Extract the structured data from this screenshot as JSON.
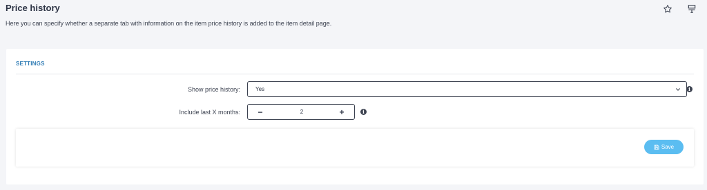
{
  "header": {
    "title": "Price history",
    "subtitle": "Here you can specify whether a separate tab with information on the item price history is added to the item detail page.",
    "icons": [
      "star-icon",
      "layout-icon"
    ]
  },
  "settings": {
    "section_title": "SETTINGS",
    "show_price_history": {
      "label": "Show price history:",
      "value": "Yes",
      "info_icon": "info-icon"
    },
    "include_last_months": {
      "label": "Include last X months:",
      "value": "2",
      "decrement": "−",
      "increment": "+",
      "info_icon": "info-icon"
    }
  },
  "actions": {
    "save_label": "Save",
    "save_icon": "floppy-disk-icon",
    "save_color": "#5bbdf1"
  },
  "colors": {
    "accent": "#2e7bb4",
    "background": "#f4f5f8"
  }
}
